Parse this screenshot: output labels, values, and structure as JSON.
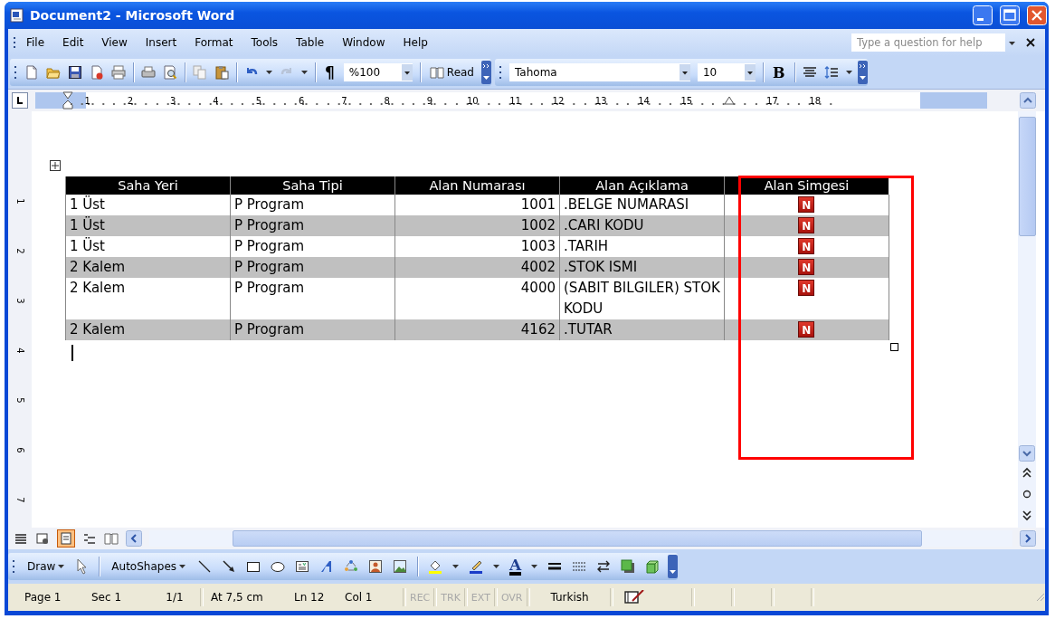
{
  "window": {
    "title": "Document2 - Microsoft Word"
  },
  "menu": [
    {
      "label": "File"
    },
    {
      "label": "Edit"
    },
    {
      "label": "View"
    },
    {
      "label": "Insert"
    },
    {
      "label": "Format"
    },
    {
      "label": "Tools"
    },
    {
      "label": "Table"
    },
    {
      "label": "Window"
    },
    {
      "label": "Help"
    }
  ],
  "help_box": {
    "placeholder": "Type a question for help"
  },
  "standard_toolbar": {
    "pilcrow": "¶",
    "zoom": "%100",
    "read": "Read"
  },
  "formatting_toolbar": {
    "font": "Tahoma",
    "size": "10",
    "bold": "B"
  },
  "ruler": {
    "items": [
      {
        "kind": "number",
        "label": "1"
      },
      {
        "kind": "number",
        "label": "2"
      },
      {
        "kind": "number",
        "label": "3"
      },
      {
        "kind": "number",
        "label": "4"
      },
      {
        "kind": "number",
        "label": "5"
      },
      {
        "kind": "number",
        "label": "6"
      },
      {
        "kind": "number",
        "label": "7"
      },
      {
        "kind": "number",
        "label": "8"
      },
      {
        "kind": "number",
        "label": "9"
      },
      {
        "kind": "number",
        "label": "10"
      },
      {
        "kind": "number",
        "label": "11"
      },
      {
        "kind": "number",
        "label": "12"
      },
      {
        "kind": "number",
        "label": "13"
      },
      {
        "kind": "number",
        "label": "14"
      },
      {
        "kind": "number",
        "label": "15"
      },
      {
        "kind": "indent"
      },
      {
        "kind": "number",
        "label": "17"
      },
      {
        "kind": "number",
        "label": "18"
      }
    ]
  },
  "vertical_ruler": {
    "labels": [
      "1",
      "2",
      "3",
      "4",
      "5",
      "6",
      "7"
    ]
  },
  "table": {
    "columns": [
      "Saha Yeri",
      "Saha Tipi",
      "Alan Numarası",
      "Alan Açıklama",
      "Alan Simgesi"
    ],
    "rows": [
      {
        "shaded": false,
        "cells": [
          "1 Üst",
          "P Program",
          "1001",
          ".BELGE NUMARASI"
        ],
        "symbol": "N"
      },
      {
        "shaded": true,
        "cells": [
          "1 Üst",
          "P Program",
          "1002",
          ".CARI  KODU"
        ],
        "symbol": "N"
      },
      {
        "shaded": false,
        "cells": [
          "1 Üst",
          "P Program",
          "1003",
          ".TARIH"
        ],
        "symbol": "N"
      },
      {
        "shaded": true,
        "cells": [
          "2 Kalem",
          "P Program",
          "4002",
          ".STOK ISMI"
        ],
        "symbol": "N"
      },
      {
        "shaded": false,
        "cells": [
          "2 Kalem",
          "P Program",
          "4000",
          "(SABIT BILGILER) STOK KODU"
        ],
        "symbol": "N"
      },
      {
        "shaded": true,
        "cells": [
          "2 Kalem",
          "P Program",
          "4162",
          ".TUTAR"
        ],
        "symbol": "N"
      }
    ]
  },
  "annotation": {
    "kind": "rectangle"
  },
  "draw_toolbar": {
    "draw": "Draw",
    "autoshapes": "AutoShapes",
    "font_color": "A"
  },
  "status_bar": {
    "page": "Page 1",
    "section": "Sec 1",
    "pages": "1/1",
    "at": "At 7,5 cm",
    "line": "Ln 12",
    "column": "Col 1",
    "modes": [
      {
        "label": "REC",
        "disabled": true
      },
      {
        "label": "TRK",
        "disabled": true
      },
      {
        "label": "EXT",
        "disabled": true
      },
      {
        "label": "OVR",
        "disabled": true
      }
    ],
    "language": "Turkish"
  }
}
